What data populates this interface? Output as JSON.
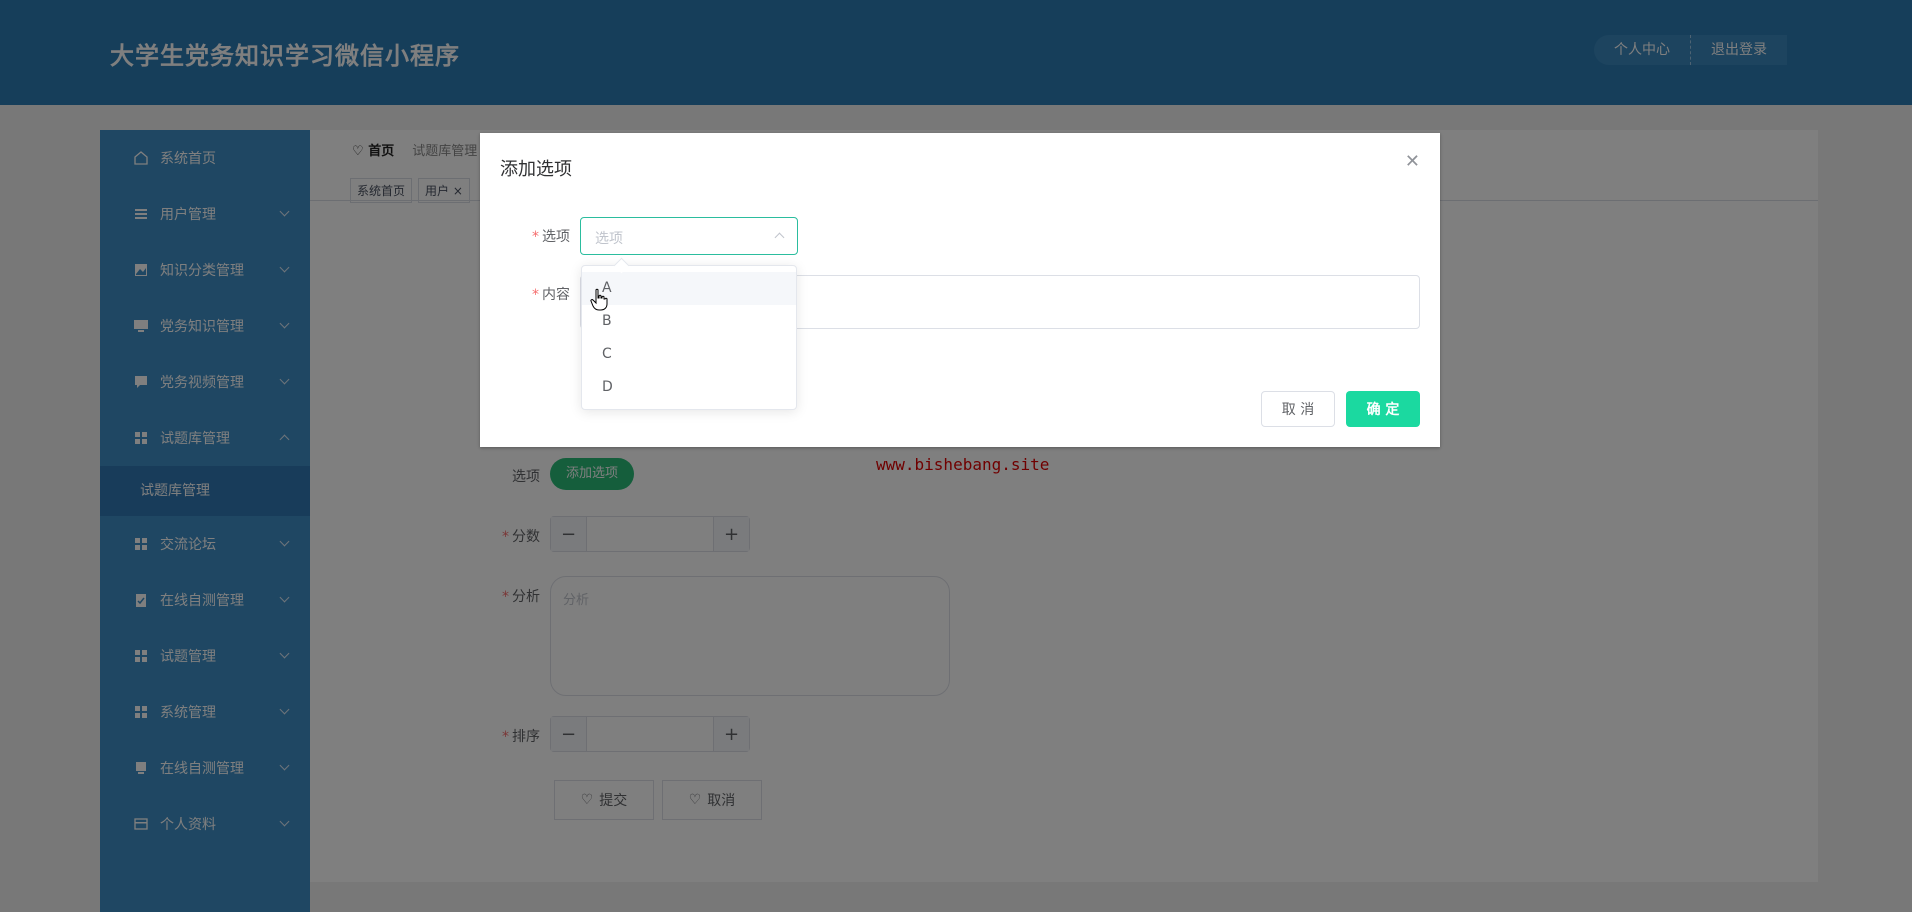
{
  "header": {
    "title": "大学生党务知识学习微信小程序",
    "profile_label": "个人中心",
    "logout_label": "退出登录"
  },
  "sidebar": {
    "items": [
      {
        "label": "系统首页",
        "icon": "home-icon"
      },
      {
        "label": "用户管理",
        "icon": "list-icon"
      },
      {
        "label": "知识分类管理",
        "icon": "image-icon"
      },
      {
        "label": "党务知识管理",
        "icon": "monitor-icon"
      },
      {
        "label": "党务视频管理",
        "icon": "chat-icon"
      },
      {
        "label": "试题库管理",
        "icon": "grid-icon",
        "expanded": true
      },
      {
        "label": "交流论坛",
        "icon": "grid-icon"
      },
      {
        "label": "在线自测管理",
        "icon": "clipboard-icon"
      },
      {
        "label": "试题管理",
        "icon": "grid-icon"
      },
      {
        "label": "系统管理",
        "icon": "grid-icon"
      },
      {
        "label": "在线自测管理",
        "icon": "receipt-icon"
      },
      {
        "label": "个人资料",
        "icon": "card-icon"
      }
    ],
    "subitem_label": "试题库管理"
  },
  "main": {
    "breadcrumb_home": "首页",
    "breadcrumb_current": "试题库管理",
    "tabs": [
      {
        "label": "系统首页"
      },
      {
        "label": "用户"
      }
    ],
    "form": {
      "options_label": "选项",
      "add_option_label": "添加选项",
      "score_label": "分数",
      "analysis_label": "分析",
      "analysis_placeholder": "分析",
      "order_label": "排序",
      "submit_label": "提交",
      "cancel_label": "取消"
    }
  },
  "watermark": "www.bishebang.site",
  "dialog": {
    "title": "添加选项",
    "option_label": "选项",
    "option_placeholder": "选项",
    "content_label": "内容",
    "cancel_label": "取 消",
    "confirm_label": "确 定",
    "dropdown_options": [
      "A",
      "B",
      "C",
      "D"
    ]
  },
  "colors": {
    "header_bg": "#2d7cb5",
    "sidebar_bg": "#3f8fc6",
    "accent_green": "#2bbd79",
    "confirm_green": "#1bd9a0",
    "watermark_red": "#e00000"
  }
}
